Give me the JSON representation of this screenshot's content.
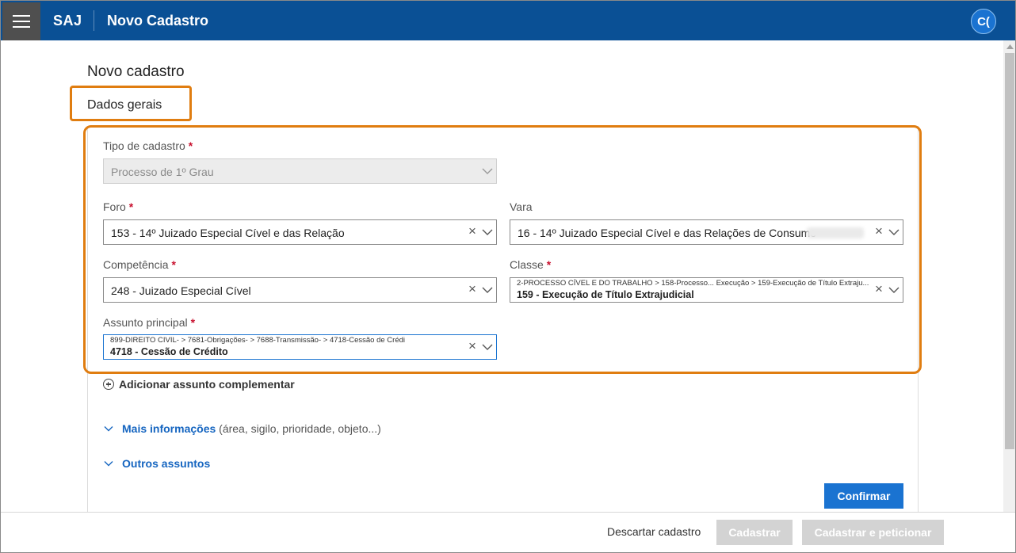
{
  "header": {
    "brand": "SAJ",
    "title": "Novo Cadastro",
    "avatar_initials": "C("
  },
  "page": {
    "heading": "Novo cadastro",
    "section_title": "Dados gerais"
  },
  "form": {
    "tipo": {
      "label": "Tipo de cadastro",
      "required": "*",
      "value": "Processo de 1º Grau"
    },
    "foro": {
      "label": "Foro",
      "required": "*",
      "value": "153 - 14º Juizado Especial Cível e das Relação"
    },
    "vara": {
      "label": "Vara",
      "value": "16 - 14º Juizado Especial Cível e das Relações de Consumo"
    },
    "competencia": {
      "label": "Competência",
      "required": "*",
      "value": "248 - Juizado Especial Cível"
    },
    "classe": {
      "label": "Classe",
      "required": "*",
      "path": "2-PROCESSO CÍVEL E DO TRABALHO > 158-Processo... Execução > 159-Execução de Título Extraju...",
      "value": "159 - Execução de Título Extrajudicial"
    },
    "assunto": {
      "label": "Assunto principal",
      "required": "*",
      "path": "899-DIREITO CIVIL- > 7681-Obrigações- > 7688-Transmissão- > 4718-Cessão de Crédi",
      "value": "4718 - Cessão de Crédito"
    }
  },
  "links": {
    "add_subject": "Adicionar assunto complementar",
    "more_info": "Mais informações",
    "more_info_hint": "(área, sigilo, prioridade, objeto...)",
    "other_subjects": "Outros assuntos"
  },
  "buttons": {
    "confirm": "Confirmar",
    "discard": "Descartar cadastro",
    "register": "Cadastrar",
    "register_petition": "Cadastrar e peticionar"
  },
  "colors": {
    "header": "#0a5095",
    "accent": "#1a73d1",
    "highlight": "#e07d10",
    "required": "#c8102e"
  }
}
